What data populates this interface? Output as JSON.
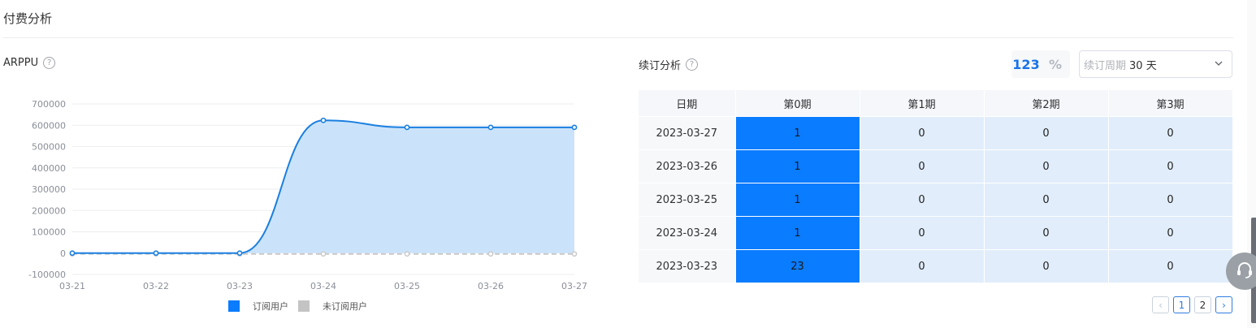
{
  "page": {
    "title": "付费分析"
  },
  "arppu": {
    "label": "ARPPU",
    "help": "?",
    "legend": [
      {
        "name": "订阅用户",
        "color": "#0a7cff"
      },
      {
        "name": "未订阅用户",
        "color": "#c4c4c4"
      }
    ]
  },
  "chart_data": {
    "type": "area",
    "x": [
      "03-21",
      "03-22",
      "03-23",
      "03-24",
      "03-25",
      "03-26",
      "03-27"
    ],
    "series": [
      {
        "name": "订阅用户",
        "values": [
          0,
          0,
          0,
          623000,
          590000,
          590000,
          590000
        ],
        "color": "#1a7fe0",
        "fill": "#cbe3fa"
      },
      {
        "name": "未订阅用户",
        "values": [
          0,
          0,
          0,
          0,
          0,
          0,
          0
        ],
        "color": "#c8c8c8"
      }
    ],
    "y_ticks": [
      "700000",
      "600000",
      "500000",
      "400000",
      "300000",
      "200000",
      "100000",
      "0",
      "-100000"
    ],
    "ylim": [
      -100000,
      700000
    ],
    "grid": true,
    "legend_position": "bottom"
  },
  "renew": {
    "label": "续订分析",
    "help": "?",
    "mode": {
      "count": "123",
      "percent": "%"
    },
    "period": {
      "prefix": "续订周期",
      "value": "30 天"
    },
    "columns": [
      "日期",
      "第0期",
      "第1期",
      "第2期",
      "第3期"
    ],
    "rows": [
      [
        "2023-03-27",
        "1",
        "0",
        "0",
        "0"
      ],
      [
        "2023-03-26",
        "1",
        "0",
        "0",
        "0"
      ],
      [
        "2023-03-25",
        "1",
        "0",
        "0",
        "0"
      ],
      [
        "2023-03-24",
        "1",
        "0",
        "0",
        "0"
      ],
      [
        "2023-03-23",
        "23",
        "0",
        "0",
        "0"
      ]
    ],
    "pagination": {
      "prev": "‹",
      "pages": [
        "1",
        "2"
      ],
      "next": "›"
    }
  }
}
